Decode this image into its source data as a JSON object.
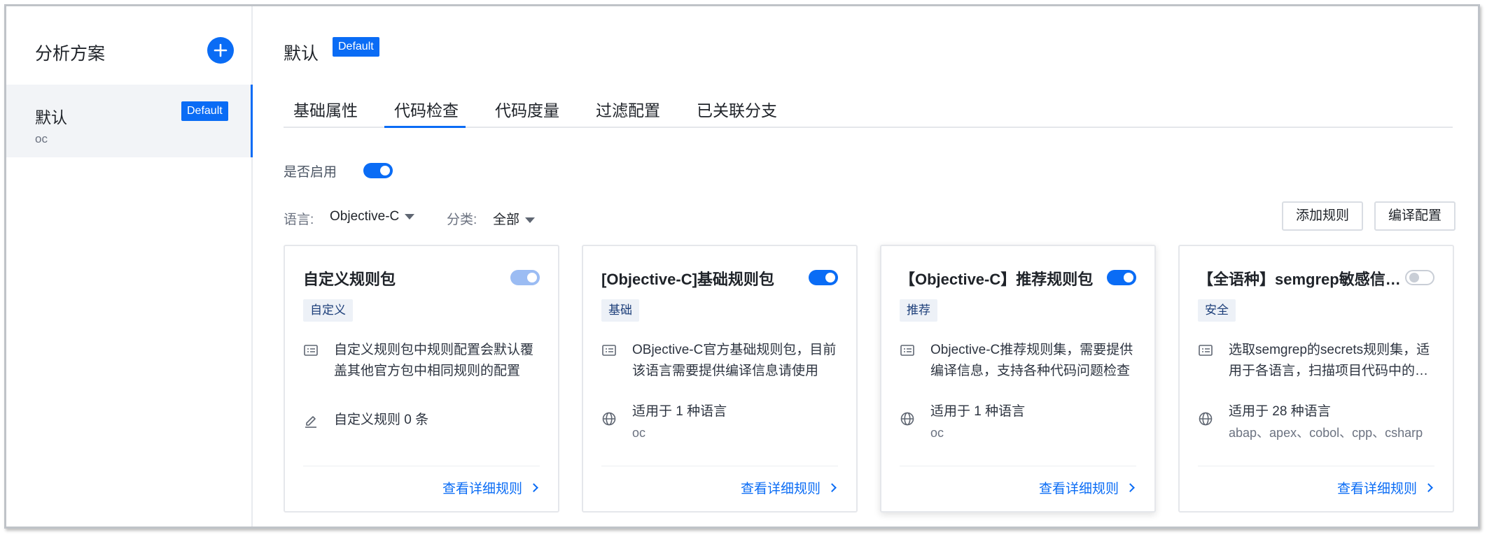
{
  "sidebar": {
    "title": "分析方案",
    "items": [
      {
        "name": "默认",
        "badge": "Default",
        "sub": "oc"
      }
    ]
  },
  "header": {
    "title": "默认",
    "badge": "Default"
  },
  "tabs": [
    {
      "label": "基础属性"
    },
    {
      "label": "代码检查"
    },
    {
      "label": "代码度量"
    },
    {
      "label": "过滤配置"
    },
    {
      "label": "已关联分支"
    }
  ],
  "active_tab": "代码检查",
  "enable": {
    "label": "是否启用",
    "on": true
  },
  "filters": {
    "language_label": "语言:",
    "language_value": "Objective-C",
    "category_label": "分类:",
    "category_value": "全部"
  },
  "actions": {
    "add_rule": "添加规则",
    "compile_config": "编译配置"
  },
  "accent_color": "#0a6cf5",
  "cards": [
    {
      "title": "自定义规则包",
      "toggle": "on-disabled",
      "tag": "自定义",
      "description": "自定义规则包中规则配置会默认覆盖其他官方包中相同规则的配置",
      "info": "自定义规则 0 条",
      "info_icon": "edit-icon",
      "info_sub": "",
      "link": "查看详细规则"
    },
    {
      "title": "[Objective-C]基础规则包",
      "toggle": "on",
      "tag": "基础",
      "description": "OBjective-C官方基础规则包，目前该语言需要提供编译信息请使用",
      "info": "适用于 1 种语言",
      "info_icon": "globe-icon",
      "info_sub": "oc",
      "link": "查看详细规则"
    },
    {
      "title": "【Objective-C】推荐规则包",
      "toggle": "on",
      "tag": "推荐",
      "description": "Objective-C推荐规则集，需要提供编译信息，支持各种代码问题检查",
      "info": "适用于 1 种语言",
      "info_icon": "globe-icon",
      "info_sub": "oc",
      "link": "查看详细规则"
    },
    {
      "title": "【全语种】semgrep敏感信息规则包",
      "toggle": "off",
      "tag": "安全",
      "description": "选取semgrep的secrets规则集，适用于各语言，扫描项目代码中的敏感信息",
      "info": "适用于 28 种语言",
      "info_icon": "globe-icon",
      "info_sub": "abap、apex、cobol、cpp、csharp",
      "link": "查看详细规则"
    }
  ]
}
